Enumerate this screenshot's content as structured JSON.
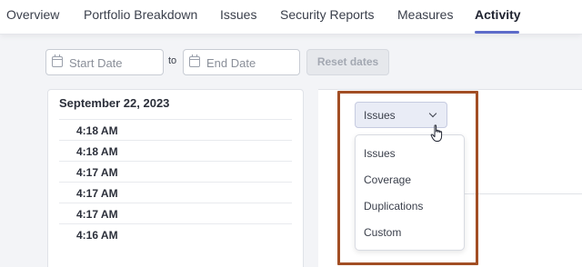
{
  "nav": {
    "tabs": [
      {
        "label": "Overview"
      },
      {
        "label": "Portfolio Breakdown"
      },
      {
        "label": "Issues"
      },
      {
        "label": "Security Reports"
      },
      {
        "label": "Measures"
      },
      {
        "label": "Activity"
      }
    ],
    "active_tab": "Activity",
    "accent_color": "#5d6bc9"
  },
  "filters": {
    "start_placeholder": "Start Date",
    "to_label": "to",
    "end_placeholder": "End Date",
    "reset_label": "Reset dates"
  },
  "activity": {
    "date": "September 22, 2023",
    "times": [
      "4:18 AM",
      "4:18 AM",
      "4:17 AM",
      "4:17 AM",
      "4:17 AM",
      "4:16 AM"
    ]
  },
  "graph_select": {
    "value": "Issues",
    "options": [
      "Issues",
      "Coverage",
      "Duplications",
      "Custom"
    ]
  },
  "highlight_color": "#a24e24"
}
